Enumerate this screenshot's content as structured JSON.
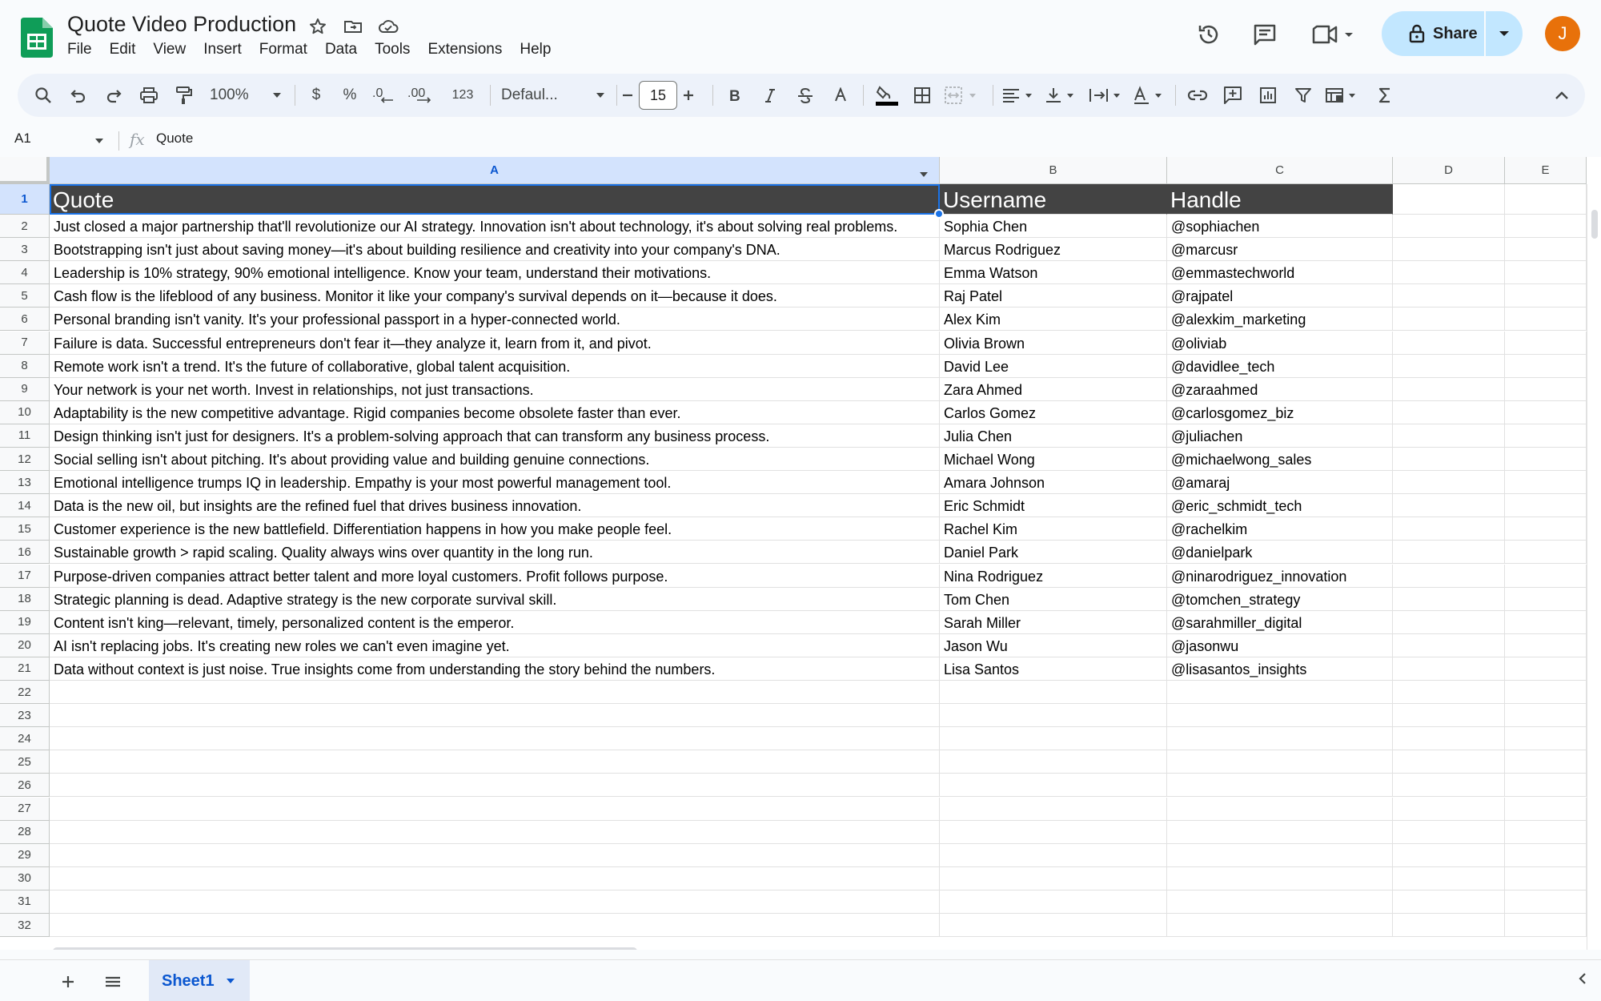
{
  "doc": {
    "title": "Quote Video Production"
  },
  "menu": [
    "File",
    "Edit",
    "View",
    "Insert",
    "Format",
    "Data",
    "Tools",
    "Extensions",
    "Help"
  ],
  "header": {
    "share_label": "Share",
    "avatar_letter": "J"
  },
  "toolbar": {
    "zoom": "100%",
    "currency": "$",
    "percent": "%",
    "decrease_decimal": ".0",
    "increase_decimal": ".00",
    "number_format": "123",
    "font": "Defaul...",
    "font_size": "15"
  },
  "formula_bar": {
    "cell_ref": "A1",
    "value": "Quote"
  },
  "columns": [
    "A",
    "B",
    "C",
    "D",
    "E"
  ],
  "rows": [
    [
      "Quote",
      "Username",
      "Handle"
    ],
    [
      "Just closed a major partnership that'll revolutionize our AI strategy. Innovation isn't about technology, it's about solving real problems.",
      "Sophia Chen",
      "@sophiachen"
    ],
    [
      "Bootstrapping isn't just about saving money—it's about building resilience and creativity into your company's DNA.",
      "Marcus Rodriguez",
      "@marcusr"
    ],
    [
      "Leadership is 10% strategy, 90% emotional intelligence. Know your team, understand their motivations.",
      "Emma Watson",
      "@emmastechworld"
    ],
    [
      "Cash flow is the lifeblood of any business. Monitor it like your company's survival depends on it—because it does.",
      "Raj Patel",
      "@rajpatel"
    ],
    [
      "Personal branding isn't vanity. It's your professional passport in a hyper-connected world.",
      "Alex Kim",
      "@alexkim_marketing"
    ],
    [
      "Failure is data. Successful entrepreneurs don't fear it—they analyze it, learn from it, and pivot.",
      "Olivia Brown",
      "@oliviab"
    ],
    [
      "Remote work isn't a trend. It's the future of collaborative, global talent acquisition.",
      "David Lee",
      "@davidlee_tech"
    ],
    [
      "Your network is your net worth. Invest in relationships, not just transactions.",
      "Zara Ahmed",
      "@zaraahmed"
    ],
    [
      "Adaptability is the new competitive advantage. Rigid companies become obsolete faster than ever.",
      "Carlos Gomez",
      "@carlosgomez_biz"
    ],
    [
      "Design thinking isn't just for designers. It's a problem-solving approach that can transform any business process.",
      "Julia Chen",
      "@juliachen"
    ],
    [
      "Social selling isn't about pitching. It's about providing value and building genuine connections.",
      "Michael Wong",
      "@michaelwong_sales"
    ],
    [
      "Emotional intelligence trumps IQ in leadership. Empathy is your most powerful management tool.",
      "Amara Johnson",
      "@amaraj"
    ],
    [
      "Data is the new oil, but insights are the refined fuel that drives business innovation.",
      "Eric Schmidt",
      "@eric_schmidt_tech"
    ],
    [
      "Customer experience is the new battlefield. Differentiation happens in how you make people feel.",
      "Rachel Kim",
      "@rachelkim"
    ],
    [
      "Sustainable growth > rapid scaling. Quality always wins over quantity in the long run.",
      "Daniel Park",
      "@danielpark"
    ],
    [
      "Purpose-driven companies attract better talent and more loyal customers. Profit follows purpose.",
      "Nina Rodriguez",
      "@ninarodriguez_innovation"
    ],
    [
      "Strategic planning is dead. Adaptive strategy is the new corporate survival skill.",
      "Tom Chen",
      "@tomchen_strategy"
    ],
    [
      "Content isn't king—relevant, timely, personalized content is the emperor.",
      "Sarah Miller",
      "@sarahmiller_digital"
    ],
    [
      "AI isn't replacing jobs. It's creating new roles we can't even imagine yet.",
      "Jason Wu",
      "@jasonwu"
    ],
    [
      "Data without context is just noise. True insights come from understanding the story behind the numbers.",
      "Lisa Santos",
      "@lisasantos_insights"
    ]
  ],
  "total_rows": 32,
  "sheets": [
    {
      "name": "Sheet1"
    }
  ],
  "colors": {
    "header_fill": "#434343",
    "accent": "#1a73e8",
    "share_bg": "#c2e7ff",
    "avatar": "#e8710a",
    "logo": "#0f9d58"
  },
  "icons": [
    "sheets-logo",
    "star-icon",
    "move-folder-icon",
    "cloud-status-icon",
    "history-icon",
    "comment-icon",
    "meet-icon",
    "lock-icon",
    "chevron-down-icon",
    "search-icon",
    "undo-icon",
    "redo-icon",
    "print-icon",
    "paint-format-icon",
    "minus-icon",
    "plus-icon",
    "bold-icon",
    "italic-icon",
    "strikethrough-icon",
    "text-color-icon",
    "fill-color-icon",
    "borders-icon",
    "merge-icon",
    "align-icon",
    "valign-icon",
    "wrap-icon",
    "rotate-icon",
    "link-icon",
    "insert-comment-icon",
    "chart-icon",
    "filter-icon",
    "filter-views-icon",
    "functions-icon",
    "collapse-icon",
    "add-sheet-icon",
    "all-sheets-icon"
  ]
}
